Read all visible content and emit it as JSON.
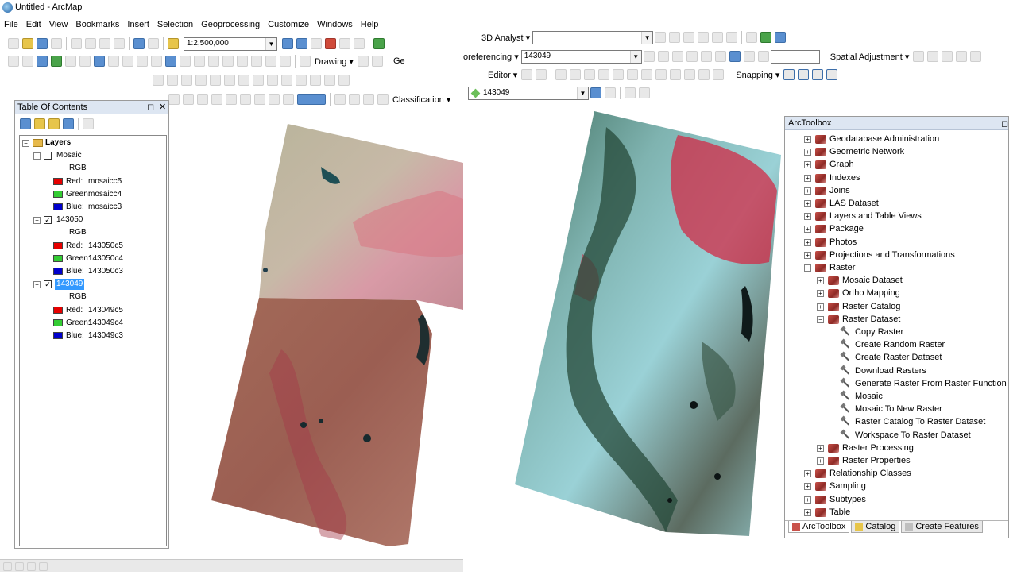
{
  "window": {
    "title": "Untitled - ArcMap"
  },
  "menu": [
    "File",
    "Edit",
    "View",
    "Bookmarks",
    "Insert",
    "Selection",
    "Geoprocessing",
    "Customize",
    "Windows",
    "Help"
  ],
  "toolbar": {
    "scale": "1:2,500,000",
    "drawing_label": "Drawing",
    "classification_label": "Classification",
    "ge_label": "Ge",
    "analyst_label": "3D Analyst",
    "georef_label": "oreferencing",
    "georef_layer": "143049",
    "spatial_adjustment_label": "Spatial Adjustment",
    "editor_label": "Editor",
    "snapping_label": "Snapping",
    "layer_combo": "143049"
  },
  "toc": {
    "title": "Table Of Contents",
    "root": "Layers",
    "layers": [
      {
        "name": "Mosaic",
        "checked": false,
        "rgb": "RGB",
        "bands": [
          {
            "label": "Red:",
            "value": "mosaicc5",
            "color": "#e60000"
          },
          {
            "label": "Green:",
            "value": "mosaicc4",
            "color": "#33cc33"
          },
          {
            "label": "Blue:",
            "value": "mosaicc3",
            "color": "#0000cc"
          }
        ]
      },
      {
        "name": "143050",
        "checked": true,
        "rgb": "RGB",
        "bands": [
          {
            "label": "Red:",
            "value": "143050c5",
            "color": "#e60000"
          },
          {
            "label": "Green:",
            "value": "143050c4",
            "color": "#33cc33"
          },
          {
            "label": "Blue:",
            "value": "143050c3",
            "color": "#0000cc"
          }
        ]
      },
      {
        "name": "143049",
        "checked": true,
        "rgb": "RGB",
        "selected": true,
        "bands": [
          {
            "label": "Red:",
            "value": "143049c5",
            "color": "#e60000"
          },
          {
            "label": "Green:",
            "value": "143049c4",
            "color": "#33cc33"
          },
          {
            "label": "Blue:",
            "value": "143049c3",
            "color": "#0000cc"
          }
        ]
      }
    ]
  },
  "toolbox": {
    "title": "ArcToolbox",
    "items": [
      {
        "label": "Geodatabase Administration",
        "level": 0,
        "type": "box",
        "exp": "+"
      },
      {
        "label": "Geometric Network",
        "level": 0,
        "type": "box",
        "exp": "+"
      },
      {
        "label": "Graph",
        "level": 0,
        "type": "box",
        "exp": "+"
      },
      {
        "label": "Indexes",
        "level": 0,
        "type": "box",
        "exp": "+"
      },
      {
        "label": "Joins",
        "level": 0,
        "type": "box",
        "exp": "+"
      },
      {
        "label": "LAS Dataset",
        "level": 0,
        "type": "box",
        "exp": "+"
      },
      {
        "label": "Layers and Table Views",
        "level": 0,
        "type": "box",
        "exp": "+"
      },
      {
        "label": "Package",
        "level": 0,
        "type": "box",
        "exp": "+"
      },
      {
        "label": "Photos",
        "level": 0,
        "type": "box",
        "exp": "+"
      },
      {
        "label": "Projections and Transformations",
        "level": 0,
        "type": "box",
        "exp": "+"
      },
      {
        "label": "Raster",
        "level": 0,
        "type": "box",
        "exp": "−"
      },
      {
        "label": "Mosaic Dataset",
        "level": 1,
        "type": "box",
        "exp": "+"
      },
      {
        "label": "Ortho Mapping",
        "level": 1,
        "type": "box",
        "exp": "+"
      },
      {
        "label": "Raster Catalog",
        "level": 1,
        "type": "box",
        "exp": "+"
      },
      {
        "label": "Raster Dataset",
        "level": 1,
        "type": "box",
        "exp": "−"
      },
      {
        "label": "Copy Raster",
        "level": 2,
        "type": "tool"
      },
      {
        "label": "Create Random Raster",
        "level": 2,
        "type": "tool"
      },
      {
        "label": "Create Raster Dataset",
        "level": 2,
        "type": "tool"
      },
      {
        "label": "Download Rasters",
        "level": 2,
        "type": "tool"
      },
      {
        "label": "Generate Raster From Raster Function",
        "level": 2,
        "type": "tool"
      },
      {
        "label": "Mosaic",
        "level": 2,
        "type": "tool"
      },
      {
        "label": "Mosaic To New Raster",
        "level": 2,
        "type": "tool"
      },
      {
        "label": "Raster Catalog To Raster Dataset",
        "level": 2,
        "type": "tool"
      },
      {
        "label": "Workspace To Raster Dataset",
        "level": 2,
        "type": "tool"
      },
      {
        "label": "Raster Processing",
        "level": 1,
        "type": "box",
        "exp": "+"
      },
      {
        "label": "Raster Properties",
        "level": 1,
        "type": "box",
        "exp": "+"
      },
      {
        "label": "Relationship Classes",
        "level": 0,
        "type": "box",
        "exp": "+"
      },
      {
        "label": "Sampling",
        "level": 0,
        "type": "box",
        "exp": "+"
      },
      {
        "label": "Subtypes",
        "level": 0,
        "type": "box",
        "exp": "+"
      },
      {
        "label": "Table",
        "level": 0,
        "type": "box",
        "exp": "+"
      }
    ],
    "tabs": [
      "ArcToolbox",
      "Catalog",
      "Create Features"
    ]
  }
}
